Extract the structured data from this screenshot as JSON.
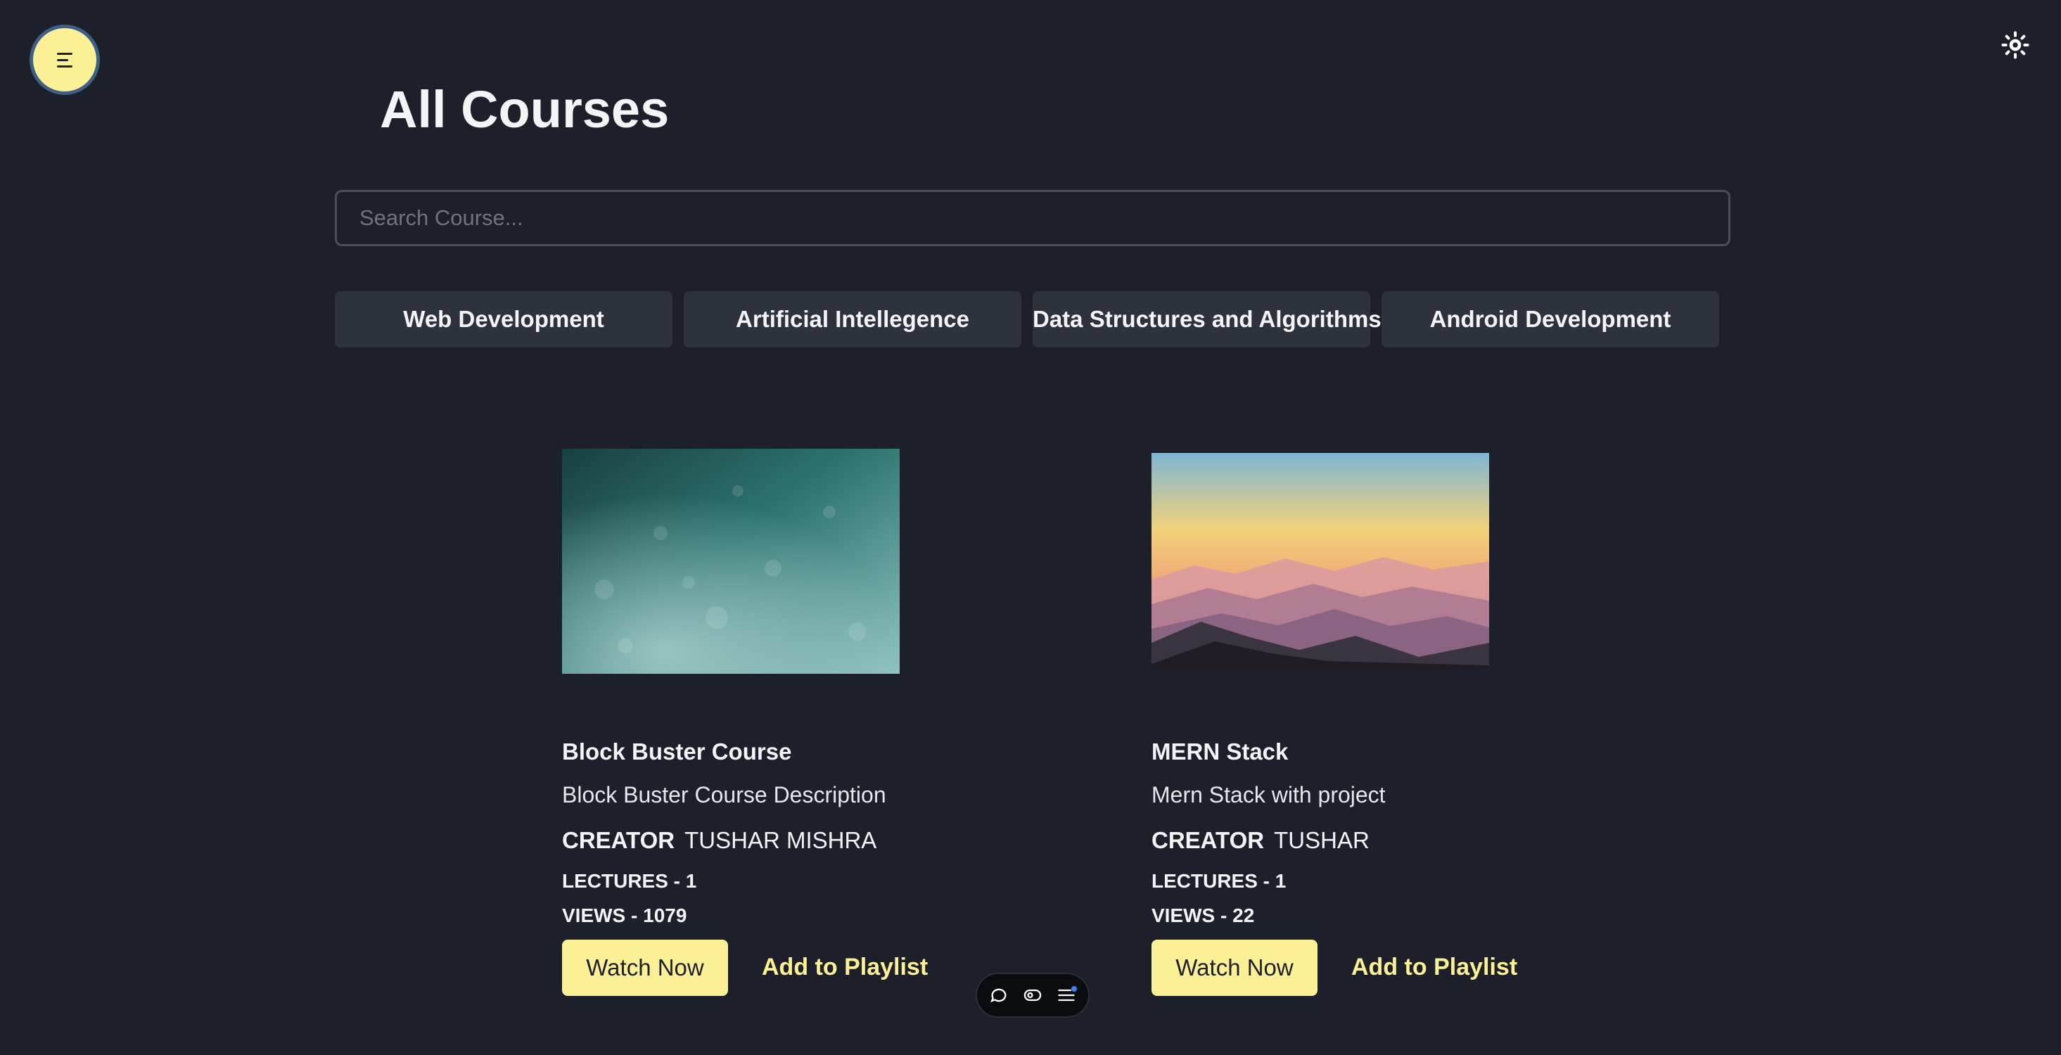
{
  "header": {
    "title": "All Courses",
    "menu_icon": "menu-icon",
    "theme_icon": "sun-icon"
  },
  "search": {
    "placeholder": "Search Course...",
    "value": ""
  },
  "categories": [
    {
      "label": "Web Development"
    },
    {
      "label": "Artificial Intellegence"
    },
    {
      "label": "Data Structures and Algorithms"
    },
    {
      "label": "Android Development"
    }
  ],
  "courses": [
    {
      "title": "Block Buster Course",
      "description": "Block Buster Course Description",
      "creator_label": "CREATOR",
      "creator": "TUSHAR MISHRA",
      "lectures": "LECTURES - 1",
      "views": "VIEWS - 1079",
      "watch_label": "Watch Now",
      "playlist_label": "Add to Playlist"
    },
    {
      "title": "MERN Stack",
      "description": "Mern Stack with project",
      "creator_label": "CREATOR",
      "creator": "TUSHAR",
      "lectures": "LECTURES - 1",
      "views": "VIEWS - 22",
      "watch_label": "Watch Now",
      "playlist_label": "Add to Playlist"
    }
  ],
  "toolbar": {
    "icons": [
      "comment-icon",
      "eye-icon",
      "list-icon"
    ]
  },
  "colors": {
    "background": "#1d202a",
    "accent": "#fbf096",
    "surface": "#2e323c"
  }
}
